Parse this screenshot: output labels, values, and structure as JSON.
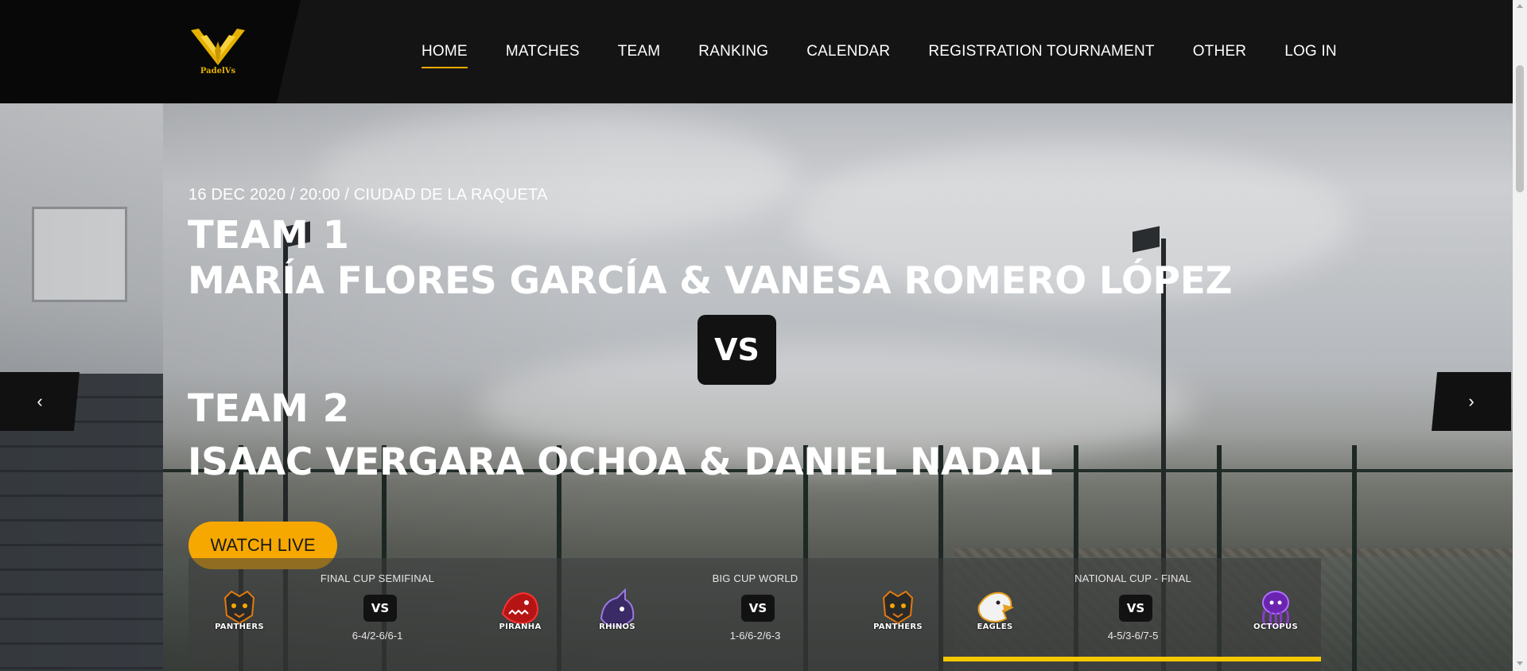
{
  "header": {
    "logo_text": "PadelVs",
    "nav": [
      {
        "label": "HOME",
        "active": true
      },
      {
        "label": "MATCHES",
        "active": false
      },
      {
        "label": "TEAM",
        "active": false
      },
      {
        "label": "RANKING",
        "active": false
      },
      {
        "label": "CALENDAR",
        "active": false
      },
      {
        "label": "REGISTRATION TOURNAMENT",
        "active": false
      },
      {
        "label": "OTHER",
        "active": false
      },
      {
        "label": "LOG IN",
        "active": false
      }
    ]
  },
  "hero": {
    "meta": "16 DEC 2020 / 20:00 / CIUDAD DE LA RAQUETA",
    "team1_label": "TEAM 1",
    "team1_players": "MARÍA FLORES GARCÍA & VANESA ROMERO LÓPEZ",
    "vs": "VS",
    "team2_label": "TEAM 2",
    "team2_players": "ISAAC VERGARA OCHOA & DANIEL NADAL",
    "watch_live": "WATCH LIVE",
    "prev_arrow": "‹",
    "next_arrow": "›"
  },
  "matches": [
    {
      "title": "FINAL CUP SEMIFINAL",
      "vs": "VS",
      "score": "6-4/2-6/6-1",
      "home": {
        "name": "PANTHERS",
        "icon": "panther-icon",
        "color": "#e07a10"
      },
      "away": {
        "name": "PIRANHA",
        "icon": "piranha-icon",
        "color": "#d01818"
      }
    },
    {
      "title": "BIG CUP WORLD",
      "vs": "VS",
      "score": "1-6/6-2/6-3",
      "home": {
        "name": "RHINOS",
        "icon": "rhino-icon",
        "color": "#7a5cc8"
      },
      "away": {
        "name": "PANTHERS",
        "icon": "panther-icon",
        "color": "#e07a10"
      }
    },
    {
      "title": "NATIONAL CUP - FINAL",
      "vs": "VS",
      "score": "4-5/3-6/7-5",
      "home": {
        "name": "EAGLES",
        "icon": "eagle-icon",
        "color": "#e8a020"
      },
      "away": {
        "name": "OCTOPUS",
        "icon": "octopus-icon",
        "color": "#8a3ad0"
      }
    }
  ],
  "slider_progress": 1.0,
  "colors": {
    "accent": "#f6a800",
    "progress": "#f6c800",
    "header_bg": "#141414"
  }
}
